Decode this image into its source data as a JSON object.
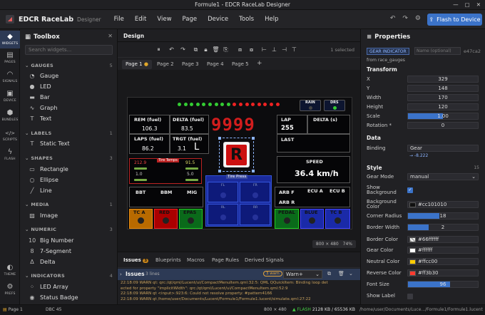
{
  "window": {
    "title": "Formule1 - EDCR RaceLab Designer",
    "controls": [
      "—",
      "▢",
      "✕"
    ]
  },
  "menubar": {
    "app_name": "EDCR RaceLab",
    "app_sub": "Designer",
    "menus": [
      "File",
      "Edit",
      "View",
      "Page",
      "Device",
      "Tools",
      "Help"
    ],
    "flash_label": "Flash to Device"
  },
  "rail": [
    {
      "label": "WIDGETS",
      "icon": "◆"
    },
    {
      "label": "PAGES",
      "icon": "▤"
    },
    {
      "label": "SIGNALS",
      "icon": "◠"
    },
    {
      "label": "DEVICE",
      "icon": "▣"
    },
    {
      "label": "BUNDLES",
      "icon": "⬢"
    },
    {
      "label": "SCRIPTS",
      "icon": "</>"
    },
    {
      "label": "FLASH",
      "icon": "ϟ"
    },
    {
      "label": "THEME",
      "icon": "◐"
    },
    {
      "label": "PREFS",
      "icon": "⚙"
    }
  ],
  "toolbox": {
    "title": "Toolbox",
    "search_placeholder": "Search widgets...",
    "categories": [
      {
        "name": "GAUGES",
        "count": "5",
        "items": [
          "Gauge",
          "LED",
          "Bar",
          "Graph",
          "Text"
        ]
      },
      {
        "name": "LABELS",
        "count": "1",
        "items": [
          "Static Text"
        ]
      },
      {
        "name": "SHAPES",
        "count": "3",
        "items": [
          "Rectangle",
          "Ellipse",
          "Line"
        ]
      },
      {
        "name": "MEDIA",
        "count": "1",
        "items": [
          "Image"
        ]
      },
      {
        "name": "NUMERIC",
        "count": "3",
        "items": [
          "Big Number",
          "7-Segment",
          "Delta"
        ]
      },
      {
        "name": "INDICATORS",
        "count": "4",
        "items": [
          "LED Array",
          "Status Badge"
        ]
      }
    ]
  },
  "center": {
    "tab": "Design",
    "selected": "1 selected",
    "pages": [
      "Page 1",
      "Page 2",
      "Page 3",
      "Page 4",
      "Page 5"
    ],
    "zoom": {
      "size": "800 × 480",
      "level": "74%"
    }
  },
  "dash": {
    "rain": "RAIN",
    "drs": "DRS",
    "rem_label": "REM (fuel)",
    "rem_val": "106.3",
    "delta_fuel_label": "DELTA (fuel)",
    "delta_fuel_val": "83.5",
    "laps_label": "LAPS (fuel)",
    "laps_val": "86.2",
    "trgt_label": "TRGT (fuel)",
    "trgt_val": "3.1",
    "trgt_big": "L",
    "big_number": "9999",
    "gear": "R",
    "lap_label": "LAP",
    "lap_val": "255",
    "delta_s_label": "DELTA (s)",
    "last_label": "LAST",
    "speed_label": "SPEED",
    "speed_val": "36.4 km/h",
    "tyre_temp": "Tire Temps",
    "tyre_press": "Tire Press",
    "tt_fl": "212.9",
    "tt_fr": "91.5",
    "tt_rl": "1.0",
    "tt_rr": "5.0",
    "bbt": "BBT",
    "bbm": "BBM",
    "mig": "MIG",
    "arb_f": "ARB F",
    "arb_r": "ARB R",
    "ecu_a": "ECU A",
    "ecu_b": "ECU B",
    "tc_a": "TC A",
    "red": "RED",
    "epas": "EPAS",
    "pedal": "PEDAL",
    "blue": "BLUE",
    "tc_b": "TC B",
    "tp": [
      "FL",
      "FR",
      "RL",
      "RR"
    ]
  },
  "bottom": {
    "tabs": [
      "Issues",
      "Blueprints",
      "Macros",
      "Page Rules",
      "Derived Signals"
    ],
    "issues_count": "3",
    "issues_title": "Issues",
    "lines": "3 lines",
    "warn_badge": "3 warn",
    "filter": "Warn+",
    "log": [
      "22:18:09 WARN  qt: qrc:/qt/qml/Lucent/ui/CompactMenuItem.qml:32:5: QML QQuickItem: Binding loop det",
      "ected for property \"implicitWidth\": qrc:/qt/qml/Lucent/ui/CompactMenuItem.qml:52:9",
      "22:18:09 WARN  qt <input>:923:6: Could not resolve property: #pattern4166",
      "22:18:09 WARN  qt /home/user/Documents/Lucent/Formule1/Formule1.lucent/simulate.qml:27:22"
    ]
  },
  "props": {
    "title": "Properties",
    "type_badge": "GEAR INDICATOR",
    "name_placeholder": "Name (optional)",
    "id": "e47ca2",
    "from": "from race_gauges",
    "transform": "Transform",
    "x": "329",
    "y": "148",
    "width": "170",
    "height": "120",
    "scale": "1.00",
    "scale_frac": 0.5,
    "rotation": "0",
    "data": "Data",
    "binding": "Gear",
    "binding_hint": "→ -8.222",
    "style": "Style",
    "style_count": "15",
    "gear_mode": "manual",
    "show_bg_label": "Show Background",
    "bg_color": "#cc101010",
    "corner_radius": "18",
    "corner_frac": 0.45,
    "border_width": "2",
    "border_frac": 0.3,
    "border_color": "#66ffffff",
    "gear_color": "#ffffff",
    "neutral_color": "#ffcc00",
    "reverse_color": "#ff3b30",
    "font_size": "96",
    "font_frac": 0.6,
    "show_label_label": "Show Label",
    "labels": {
      "x": "X",
      "y": "Y",
      "width": "Width",
      "height": "Height",
      "scale": "Scale",
      "rotation": "Rotation *",
      "binding": "Binding",
      "gear_mode": "Gear Mode",
      "bg_color": "Background Color",
      "corner_radius": "Corner Radius",
      "border_width": "Border Width",
      "border_color": "Border Color",
      "gear_color": "Gear Color",
      "neutral_color": "Neutral Color",
      "reverse_color": "Reverse Color",
      "font_size": "Font Size"
    }
  },
  "status": {
    "page": "Page 1",
    "dbc": "DBC",
    "dbc_val": "45",
    "res": "800 × 480",
    "flash": "FLASH",
    "flash_val": "2128 KB / 65536 KB",
    "path": "/home/user/Documents/Luce.../Formule1/Formule1.lucent"
  }
}
